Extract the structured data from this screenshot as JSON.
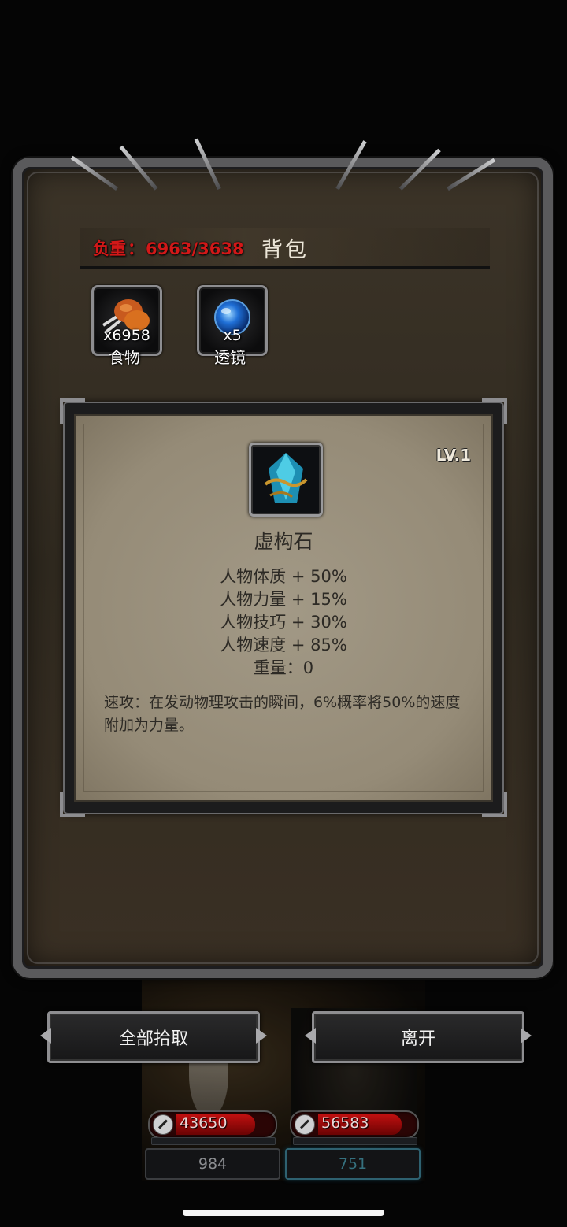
{
  "header": {
    "weight_label": "负重",
    "weight_sep": "：",
    "weight_value": "6963/3638",
    "title": "背包"
  },
  "inventory": [
    {
      "qty": "x6958",
      "label": "食物",
      "icon": "roasted-meat-icon"
    },
    {
      "qty": "x5",
      "label": "透镜",
      "icon": "blue-lens-icon"
    }
  ],
  "item_detail": {
    "icon": "crystal-rune-icon",
    "level": "LV.1",
    "name": "虚构石",
    "stats": [
      "人物体质 + 50%",
      "人物力量 + 15%",
      "人物技巧 + 30%",
      "人物速度 + 85%",
      "重量：0"
    ],
    "description": "速攻：在发动物理攻击的瞬间，6%概率将50%的速度附加为力量。"
  },
  "buttons": {
    "pick_all": "全部拾取",
    "leave": "离开"
  },
  "party": [
    {
      "hp": "43650",
      "hp_fraction": 0.85,
      "mp": "984",
      "active": false
    },
    {
      "hp": "56583",
      "hp_fraction": 0.9,
      "mp": "751",
      "active": true
    }
  ],
  "colors": {
    "weight_text": "#d21818",
    "hp_fill": "#c01010",
    "active_mp_border": "#2e6170"
  }
}
